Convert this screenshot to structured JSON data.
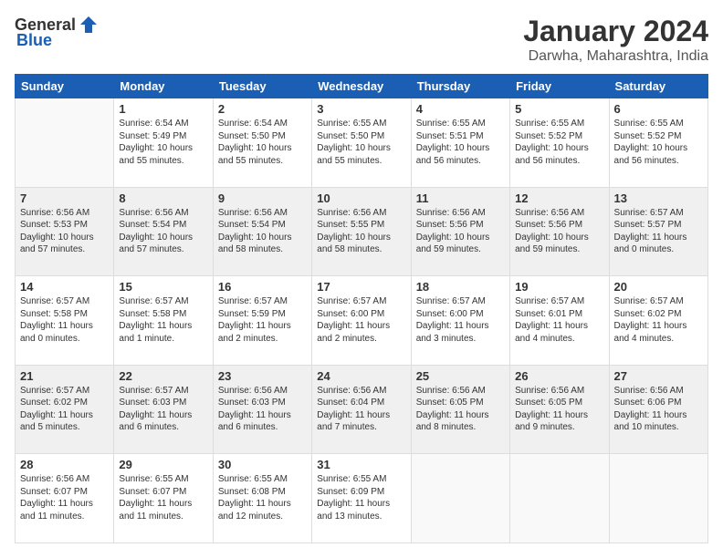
{
  "header": {
    "logo_general": "General",
    "logo_blue": "Blue",
    "month_title": "January 2024",
    "location": "Darwha, Maharashtra, India"
  },
  "days_of_week": [
    "Sunday",
    "Monday",
    "Tuesday",
    "Wednesday",
    "Thursday",
    "Friday",
    "Saturday"
  ],
  "weeks": [
    [
      {
        "day": "",
        "info": ""
      },
      {
        "day": "1",
        "info": "Sunrise: 6:54 AM\nSunset: 5:49 PM\nDaylight: 10 hours\nand 55 minutes."
      },
      {
        "day": "2",
        "info": "Sunrise: 6:54 AM\nSunset: 5:50 PM\nDaylight: 10 hours\nand 55 minutes."
      },
      {
        "day": "3",
        "info": "Sunrise: 6:55 AM\nSunset: 5:50 PM\nDaylight: 10 hours\nand 55 minutes."
      },
      {
        "day": "4",
        "info": "Sunrise: 6:55 AM\nSunset: 5:51 PM\nDaylight: 10 hours\nand 56 minutes."
      },
      {
        "day": "5",
        "info": "Sunrise: 6:55 AM\nSunset: 5:52 PM\nDaylight: 10 hours\nand 56 minutes."
      },
      {
        "day": "6",
        "info": "Sunrise: 6:55 AM\nSunset: 5:52 PM\nDaylight: 10 hours\nand 56 minutes."
      }
    ],
    [
      {
        "day": "7",
        "info": "Sunrise: 6:56 AM\nSunset: 5:53 PM\nDaylight: 10 hours\nand 57 minutes."
      },
      {
        "day": "8",
        "info": "Sunrise: 6:56 AM\nSunset: 5:54 PM\nDaylight: 10 hours\nand 57 minutes."
      },
      {
        "day": "9",
        "info": "Sunrise: 6:56 AM\nSunset: 5:54 PM\nDaylight: 10 hours\nand 58 minutes."
      },
      {
        "day": "10",
        "info": "Sunrise: 6:56 AM\nSunset: 5:55 PM\nDaylight: 10 hours\nand 58 minutes."
      },
      {
        "day": "11",
        "info": "Sunrise: 6:56 AM\nSunset: 5:56 PM\nDaylight: 10 hours\nand 59 minutes."
      },
      {
        "day": "12",
        "info": "Sunrise: 6:56 AM\nSunset: 5:56 PM\nDaylight: 10 hours\nand 59 minutes."
      },
      {
        "day": "13",
        "info": "Sunrise: 6:57 AM\nSunset: 5:57 PM\nDaylight: 11 hours\nand 0 minutes."
      }
    ],
    [
      {
        "day": "14",
        "info": "Sunrise: 6:57 AM\nSunset: 5:58 PM\nDaylight: 11 hours\nand 0 minutes."
      },
      {
        "day": "15",
        "info": "Sunrise: 6:57 AM\nSunset: 5:58 PM\nDaylight: 11 hours\nand 1 minute."
      },
      {
        "day": "16",
        "info": "Sunrise: 6:57 AM\nSunset: 5:59 PM\nDaylight: 11 hours\nand 2 minutes."
      },
      {
        "day": "17",
        "info": "Sunrise: 6:57 AM\nSunset: 6:00 PM\nDaylight: 11 hours\nand 2 minutes."
      },
      {
        "day": "18",
        "info": "Sunrise: 6:57 AM\nSunset: 6:00 PM\nDaylight: 11 hours\nand 3 minutes."
      },
      {
        "day": "19",
        "info": "Sunrise: 6:57 AM\nSunset: 6:01 PM\nDaylight: 11 hours\nand 4 minutes."
      },
      {
        "day": "20",
        "info": "Sunrise: 6:57 AM\nSunset: 6:02 PM\nDaylight: 11 hours\nand 4 minutes."
      }
    ],
    [
      {
        "day": "21",
        "info": "Sunrise: 6:57 AM\nSunset: 6:02 PM\nDaylight: 11 hours\nand 5 minutes."
      },
      {
        "day": "22",
        "info": "Sunrise: 6:57 AM\nSunset: 6:03 PM\nDaylight: 11 hours\nand 6 minutes."
      },
      {
        "day": "23",
        "info": "Sunrise: 6:56 AM\nSunset: 6:03 PM\nDaylight: 11 hours\nand 6 minutes."
      },
      {
        "day": "24",
        "info": "Sunrise: 6:56 AM\nSunset: 6:04 PM\nDaylight: 11 hours\nand 7 minutes."
      },
      {
        "day": "25",
        "info": "Sunrise: 6:56 AM\nSunset: 6:05 PM\nDaylight: 11 hours\nand 8 minutes."
      },
      {
        "day": "26",
        "info": "Sunrise: 6:56 AM\nSunset: 6:05 PM\nDaylight: 11 hours\nand 9 minutes."
      },
      {
        "day": "27",
        "info": "Sunrise: 6:56 AM\nSunset: 6:06 PM\nDaylight: 11 hours\nand 10 minutes."
      }
    ],
    [
      {
        "day": "28",
        "info": "Sunrise: 6:56 AM\nSunset: 6:07 PM\nDaylight: 11 hours\nand 11 minutes."
      },
      {
        "day": "29",
        "info": "Sunrise: 6:55 AM\nSunset: 6:07 PM\nDaylight: 11 hours\nand 11 minutes."
      },
      {
        "day": "30",
        "info": "Sunrise: 6:55 AM\nSunset: 6:08 PM\nDaylight: 11 hours\nand 12 minutes."
      },
      {
        "day": "31",
        "info": "Sunrise: 6:55 AM\nSunset: 6:09 PM\nDaylight: 11 hours\nand 13 minutes."
      },
      {
        "day": "",
        "info": ""
      },
      {
        "day": "",
        "info": ""
      },
      {
        "day": "",
        "info": ""
      }
    ]
  ]
}
